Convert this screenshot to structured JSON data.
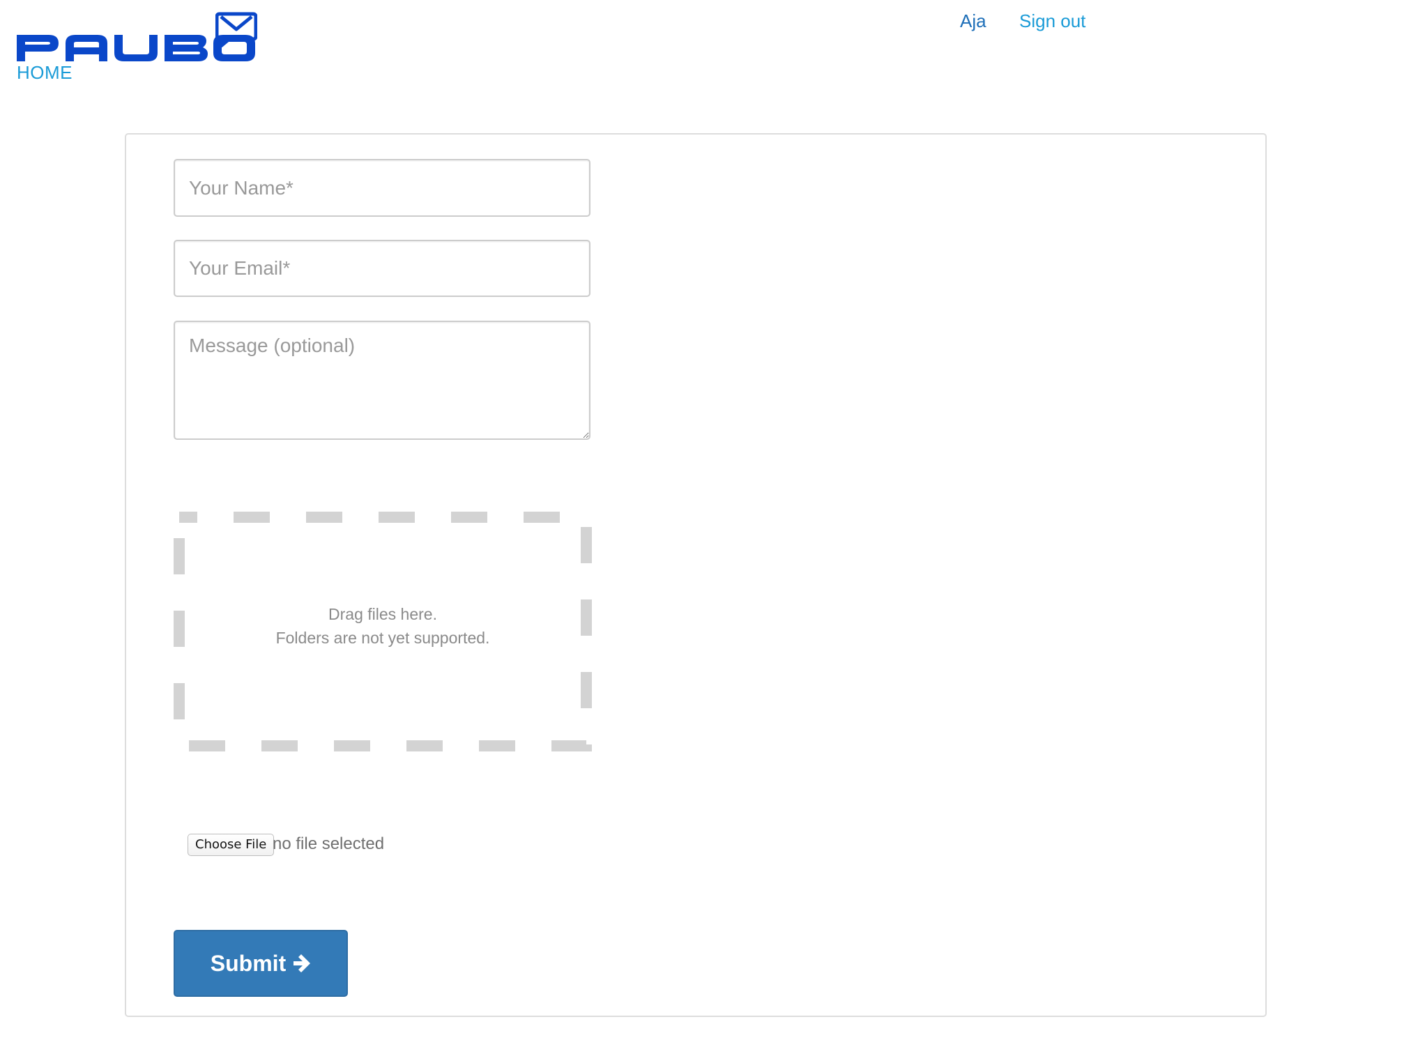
{
  "header": {
    "brand_name": "PAUBOX",
    "home_link": "HOME",
    "user_name": "Aja",
    "sign_out": "Sign out"
  },
  "form": {
    "name_placeholder": "Your Name*",
    "email_placeholder": "Your Email*",
    "message_placeholder": "Message (optional)",
    "dropzone_line1": "Drag files here.",
    "dropzone_line2": "Folders are not yet supported.",
    "file_button_label": "Choose File",
    "file_status": "no file selected",
    "submit_label": "Submit"
  },
  "colors": {
    "brand_blue": "#0a47c9",
    "link_blue": "#1a9bd7",
    "button_blue": "#337ab7",
    "dropzone_dash": "#d3d3d3"
  },
  "icons": {
    "logo_mark": "envelope-icon",
    "submit": "arrow-right-icon"
  }
}
